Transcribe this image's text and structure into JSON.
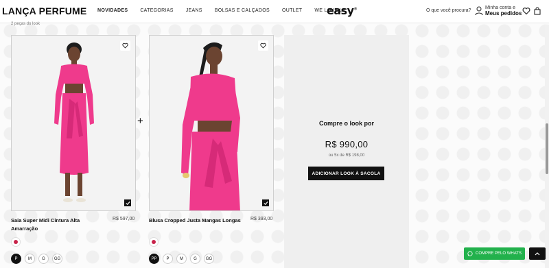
{
  "header": {
    "brand": "LANÇA PERFUME",
    "nav": [
      "NOVIDADES",
      "CATEGORIAS",
      "JEANS",
      "BOLSAS E CALÇADOS",
      "OUTLET",
      "WE LOVE LP"
    ],
    "logo": "easy",
    "logo_mark": "®",
    "search_label": "O que você procura?",
    "account_line1": "Minha conta e",
    "account_line2": "Meus pedidos",
    "icons": [
      "account-icon",
      "heart-icon",
      "bag-icon"
    ]
  },
  "look": {
    "pieces_label": "2 peças do look",
    "plus": "+",
    "products": [
      {
        "name": "Saia Super Midi Cintura Alta Amarração",
        "price": "R$ 597,00",
        "color": "#c8234a",
        "sizes": [
          "P",
          "M",
          "G",
          "GG"
        ],
        "selected_size": "P"
      },
      {
        "name": "Blusa Cropped Justa Mangas Longas",
        "price": "R$ 393,00",
        "color": "#c8234a",
        "sizes": [
          "PP",
          "P",
          "M",
          "G",
          "GG"
        ],
        "selected_size": "PP"
      }
    ]
  },
  "buy": {
    "title": "Compre o look por",
    "price": "R$ 990,00",
    "installments": "ou 5x de R$ 198,00",
    "button": "ADICIONAR LOOK À SACOLA"
  },
  "floating": {
    "whats_label": "COMPRE PELO WHATS",
    "whats_color": "#22b14c"
  },
  "colors": {
    "accent": "#111111",
    "garment": "#ef3a8c"
  }
}
